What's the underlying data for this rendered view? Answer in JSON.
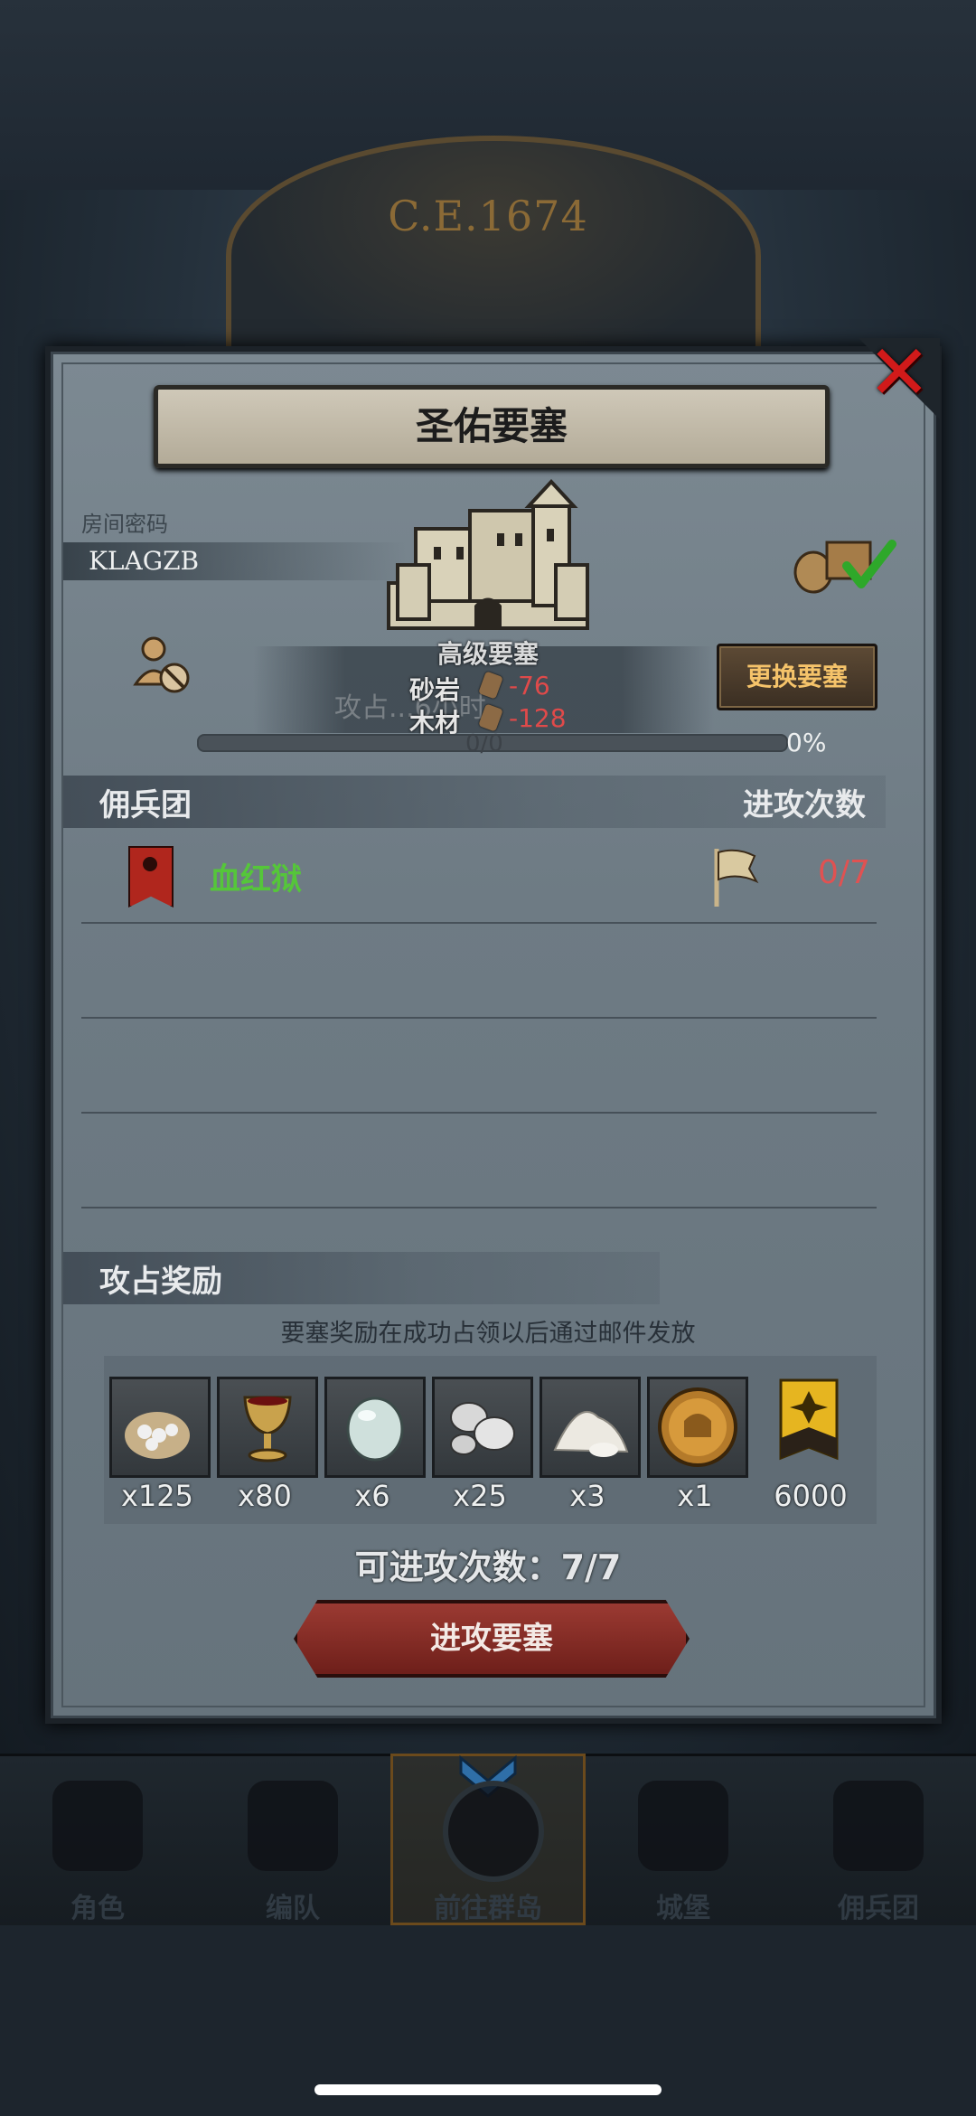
{
  "background": {
    "year": "C.E.1674"
  },
  "dialog": {
    "title": "圣佑要塞",
    "room_password_label": "房间密码",
    "room_password": "KLAGZB",
    "fortress_level": "高级要塞",
    "background_info": "攻占...6小时",
    "resources": [
      {
        "name": "砂岩",
        "delta": "-76"
      },
      {
        "name": "木材",
        "delta": "-128"
      }
    ],
    "change_button": "更换要塞",
    "progress_count": "0/0",
    "progress_percent": "0%",
    "progress_fraction": 0,
    "mercenary_header": "佣兵团",
    "attack_count_header": "进攻次数",
    "mercenaries": [
      {
        "name": "血红狱",
        "attack_count": "0/7"
      }
    ],
    "reward_header": "攻占奖励",
    "reward_note": "要塞奖励在成功占领以后通过邮件发放",
    "rewards": [
      {
        "icon": "silver-sack-icon",
        "qty": "x125"
      },
      {
        "icon": "goblet-icon",
        "qty": "x80"
      },
      {
        "icon": "gem-stone-icon",
        "qty": "x6"
      },
      {
        "icon": "silver-ore-icon",
        "qty": "x25"
      },
      {
        "icon": "salt-pile-icon",
        "qty": "x3"
      },
      {
        "icon": "gold-medal-icon",
        "qty": "x1"
      },
      {
        "icon": "honor-badge-icon",
        "qty": "6000"
      }
    ],
    "attempts_text": "可进攻次数：7/7",
    "attack_button": "进攻要塞"
  },
  "nav": [
    {
      "label": "角色",
      "icon": "knight-icon"
    },
    {
      "label": "编队",
      "icon": "helmet-icon"
    },
    {
      "label": "前往群岛",
      "icon": "globe-icon",
      "active": true
    },
    {
      "label": "城堡",
      "icon": "castle-icon"
    },
    {
      "label": "佣兵团",
      "icon": "mercenary-icon"
    }
  ],
  "colors": {
    "accent_green": "#55c63a",
    "warning_red": "#e05252",
    "gold": "#f5c36a"
  }
}
